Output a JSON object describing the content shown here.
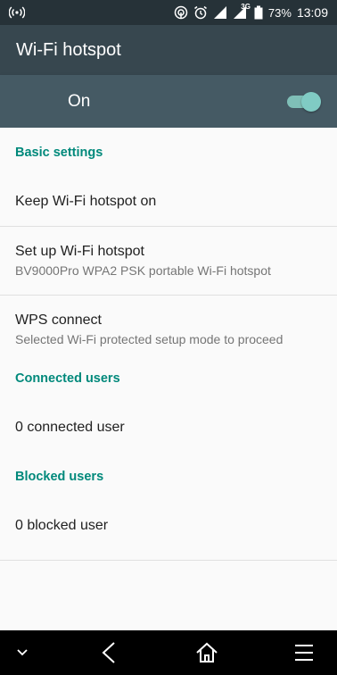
{
  "status_bar": {
    "battery_percent": "73%",
    "network_type": "3G",
    "time": "13:09",
    "icons": [
      "hotspot-icon",
      "cast-icon",
      "alarm-icon",
      "wifi-signal-icon",
      "cellular-signal-icon",
      "battery-icon"
    ]
  },
  "app_bar": {
    "title": "Wi-Fi hotspot"
  },
  "master_switch": {
    "label": "On",
    "state": true,
    "accent": "#80cbc4"
  },
  "sections": {
    "basic": {
      "header": "Basic settings",
      "keep_on": {
        "title": "Keep Wi-Fi hotspot on"
      },
      "setup": {
        "title": "Set up Wi-Fi hotspot",
        "summary": "BV9000Pro WPA2 PSK portable Wi-Fi hotspot"
      },
      "wps": {
        "title": "WPS connect",
        "summary": "Selected Wi-Fi protected setup mode to proceed"
      }
    },
    "connected": {
      "header": "Connected users",
      "value": "0 connected user"
    },
    "blocked": {
      "header": "Blocked users",
      "value": "0 blocked user"
    }
  },
  "nav_bar": {
    "icons": [
      "chevron-down-icon",
      "back-icon",
      "home-icon",
      "menu-icon"
    ]
  },
  "colors": {
    "status_bar": "#263238",
    "app_bar": "#37474f",
    "switch_bar": "#455a64",
    "section_header": "#00897b"
  }
}
